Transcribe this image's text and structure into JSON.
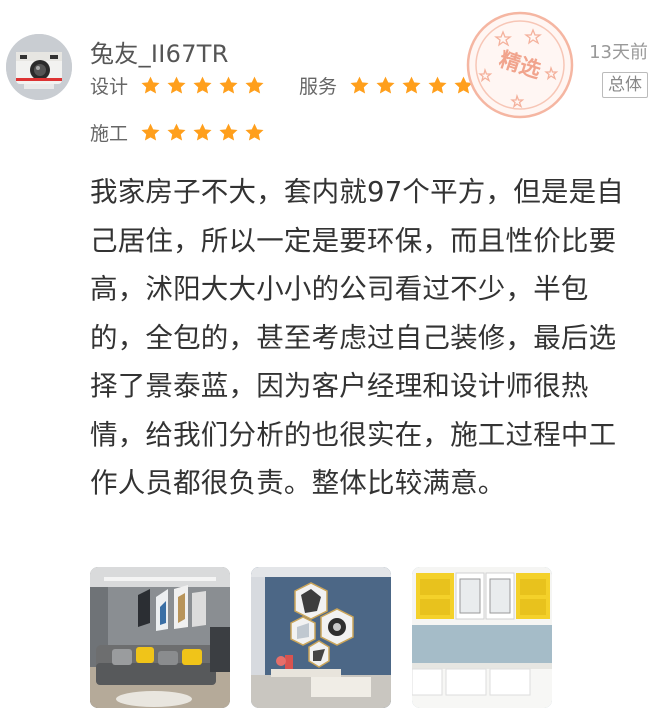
{
  "review": {
    "username": "兔友_II67TR",
    "date": "13天前",
    "tag": "总体",
    "badge": "精选",
    "ratings": [
      {
        "label": "设计",
        "stars": 5
      },
      {
        "label": "服务",
        "stars": 5
      },
      {
        "label": "施工",
        "stars": 5
      }
    ],
    "text": "我家房子不大，套内就97个平方，但是是自己居住，所以一定是要环保，而且性价比要高，沭阳大大小小的公司看过不少，半包的，全包的，甚至考虑过自己装修，最后选择了景泰蓝，因为客户经理和设计师很热情，给我们分析的也很实在，施工过程中工作人员都很负责。整体比较满意。",
    "photos": [
      {
        "name": "living-room-sofa-photo"
      },
      {
        "name": "hexagon-wall-decor-photo"
      },
      {
        "name": "yellow-cabinet-photo"
      }
    ]
  },
  "colors": {
    "star": "#FF9F1C",
    "stamp": "#F7B9A6",
    "text": "#333333",
    "muted": "#999999"
  },
  "icons": {
    "star": "star-icon",
    "avatar": "camera-avatar"
  }
}
